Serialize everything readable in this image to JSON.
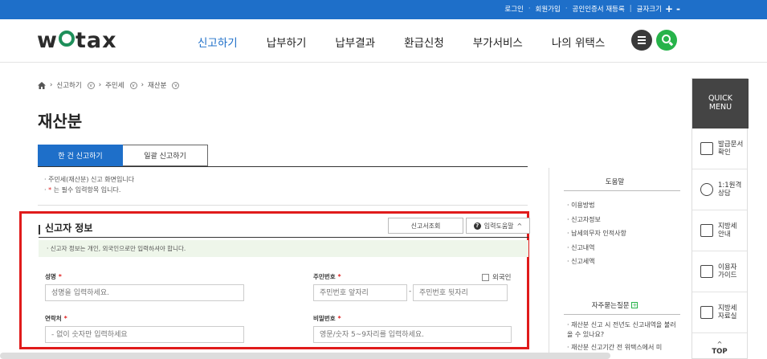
{
  "topbar": {
    "links": [
      "로그인",
      "회원가입",
      "공인인증서 재등록",
      "글자크기"
    ],
    "font_plus": "+",
    "font_minus": "-"
  },
  "header": {
    "logo_left": "w",
    "logo_right": "tax",
    "nav": [
      "신고하기",
      "납부하기",
      "납부결과",
      "환급신청",
      "부가서비스",
      "나의 위택스"
    ],
    "active_nav": "신고하기"
  },
  "breadcrumb": {
    "items": [
      "신고하기",
      "주민세",
      "재산분"
    ]
  },
  "page": {
    "title": "재산분"
  },
  "tabs": [
    {
      "label": "한 건 신고하기",
      "active": true
    },
    {
      "label": "일괄 신고하기",
      "active": false
    }
  ],
  "notice": {
    "line1": "· 주민세(재산분) 신고 화면입니다",
    "line2_prefix": "· ",
    "line2_star": "*",
    "line2_text": " 는 필수 입력항목 입니다."
  },
  "reporter": {
    "title": "신고자 정보",
    "lookup_button": "신고서조회",
    "help_button": "입력도움말",
    "info": "· 신고자 정보는 개인, 외국인으로만 입력하셔야 합니다.",
    "foreigner_label": "외국인",
    "name_label": "성명",
    "name_placeholder": "성명을 입력하세요.",
    "rrn_label": "주민번호",
    "rrn_front_placeholder": "주민번호 앞자리",
    "rrn_back_placeholder": "주민번호 뒷자리",
    "rrn_dash": "-",
    "contact_label": "연락처",
    "contact_placeholder": "- 없이 숫자만 입력하세요",
    "password_label": "비밀번호",
    "password_placeholder": "영문/숫자 5~9자리를 입력하세요.",
    "required_mark": "*"
  },
  "help": {
    "title": "도움말",
    "items": [
      "· 이용방법",
      "· 신고자정보",
      "· 납세의무자 인적사항",
      "· 신고내역",
      "· 신고세액"
    ],
    "faq_title": "자주묻는질문",
    "faq_plus": "+",
    "faq_items": [
      "· 재산분 신고 시 전년도 신고내역을 불러올 수 있나요?",
      "· 재산분 신고기간 전 위택스에서 미"
    ]
  },
  "quick": {
    "head_line1": "QUICK",
    "head_line2": "MENU",
    "items": [
      {
        "icon": "printer-icon",
        "label": "발급문서\n확인"
      },
      {
        "icon": "headset-icon",
        "label": "1:1원격\n상담"
      },
      {
        "icon": "tax-info-icon",
        "label": "지방세\n안내"
      },
      {
        "icon": "guide-icon",
        "label": "이용자\n가이드"
      },
      {
        "icon": "archive-search-icon",
        "label": "지방세\n자료실"
      }
    ],
    "top_label": "TOP",
    "top_chevron": "^"
  }
}
